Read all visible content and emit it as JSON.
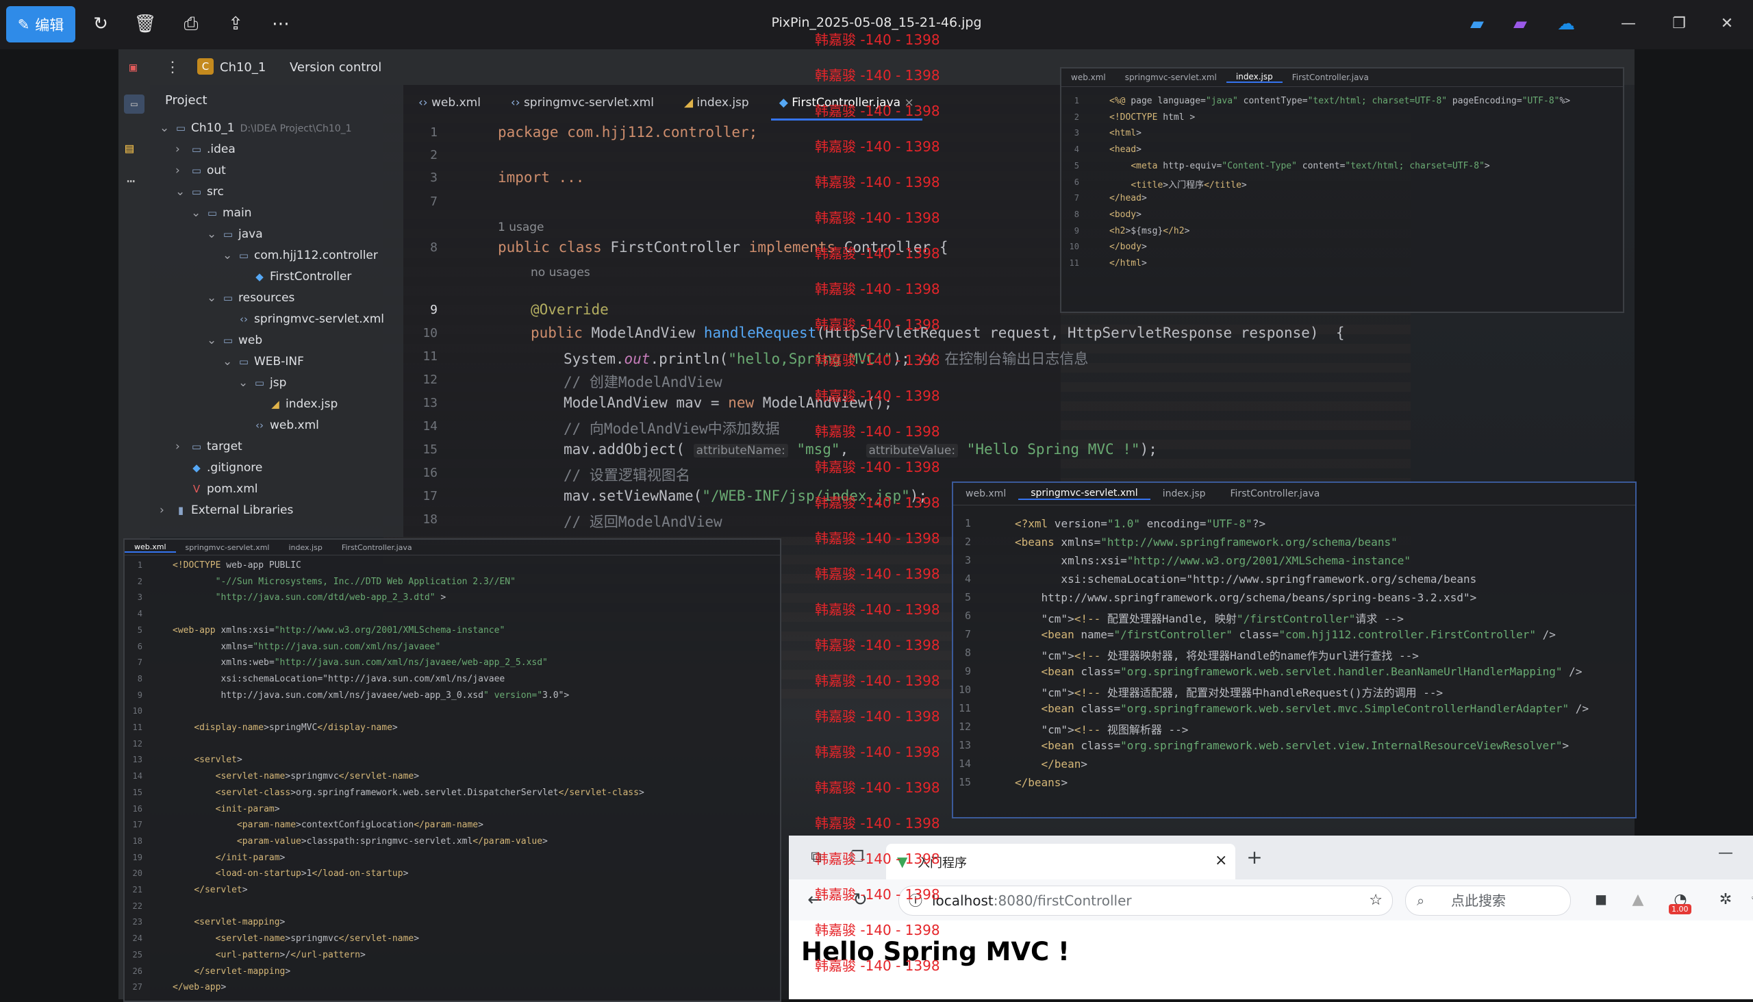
{
  "viewer": {
    "edit_label": "编辑",
    "title": "PixPin_2025-05-08_15-21-46.jpg",
    "icons": [
      "rotate-icon",
      "delete-icon",
      "print-icon",
      "share-icon",
      "more-icon"
    ]
  },
  "ide": {
    "project_initial": "C",
    "project_name": "Ch10_1",
    "vcs": "Version control",
    "panel_title": "Project",
    "tree": [
      {
        "indent": 0,
        "arrow": "⌄",
        "icon": "▭",
        "label": "Ch10_1",
        "suffix": "D:\\IDEA Project\\Ch10_1"
      },
      {
        "indent": 1,
        "arrow": "›",
        "icon": "▭",
        "label": ".idea",
        "suffix": ""
      },
      {
        "indent": 1,
        "arrow": "›",
        "icon": "▭",
        "label": "out",
        "suffix": ""
      },
      {
        "indent": 1,
        "arrow": "⌄",
        "icon": "▭",
        "label": "src",
        "suffix": ""
      },
      {
        "indent": 2,
        "arrow": "⌄",
        "icon": "▭",
        "label": "main",
        "suffix": ""
      },
      {
        "indent": 3,
        "arrow": "⌄",
        "icon": "▭",
        "label": "java",
        "suffix": ""
      },
      {
        "indent": 4,
        "arrow": "⌄",
        "icon": "▭",
        "label": "com.hjj112.controller",
        "suffix": ""
      },
      {
        "indent": 5,
        "arrow": "",
        "icon": "◆",
        "label": "FirstController",
        "suffix": ""
      },
      {
        "indent": 3,
        "arrow": "⌄",
        "icon": "▭",
        "label": "resources",
        "suffix": ""
      },
      {
        "indent": 4,
        "arrow": "",
        "icon": "‹›",
        "label": "springmvc-servlet.xml",
        "suffix": ""
      },
      {
        "indent": 3,
        "arrow": "⌄",
        "icon": "▭",
        "label": "web",
        "suffix": ""
      },
      {
        "indent": 4,
        "arrow": "⌄",
        "icon": "▭",
        "label": "WEB-INF",
        "suffix": ""
      },
      {
        "indent": 5,
        "arrow": "⌄",
        "icon": "▭",
        "label": "jsp",
        "suffix": ""
      },
      {
        "indent": 6,
        "arrow": "",
        "icon": "◢",
        "label": "index.jsp",
        "suffix": ""
      },
      {
        "indent": 5,
        "arrow": "",
        "icon": "‹›",
        "label": "web.xml",
        "suffix": ""
      },
      {
        "indent": 1,
        "arrow": "›",
        "icon": "▭",
        "label": "target",
        "suffix": ""
      },
      {
        "indent": 1,
        "arrow": "",
        "icon": "◆",
        "label": ".gitignore",
        "suffix": ""
      },
      {
        "indent": 1,
        "arrow": "",
        "icon": "V",
        "label": "pom.xml",
        "suffix": ""
      },
      {
        "indent": 0,
        "arrow": "›",
        "icon": "▮",
        "label": "External Libraries",
        "suffix": ""
      }
    ],
    "tabs": [
      "web.xml",
      "springmvc-servlet.xml",
      "index.jsp",
      "FirstController.java"
    ],
    "line_numbers": [
      "1",
      "2",
      "3",
      "7",
      "",
      "8",
      "",
      "",
      "9",
      "10",
      "11",
      "12",
      "13",
      "14",
      "15",
      "16",
      "17",
      "18"
    ],
    "code": {
      "l1": "package com.hjj112.controller;",
      "l3": "import ...",
      "usage": "1 usage",
      "l8a": "public class ",
      "l8b": "FirstController ",
      "l8c": "implements ",
      "l8d": "Controller {",
      "no_usages": "no usages",
      "override": "@Override",
      "l10a": "public ",
      "l10b": "ModelAndView ",
      "l10c": "handleRequest",
      "l10d": "(HttpServletRequest request, HttpServletResponse response)  {",
      "l11a": "System.",
      "l11b": "out",
      "l11c": ".println(",
      "l11d": "\"hello,Spring MVC!\"",
      "l11e": "); ",
      "l11f": "// 在控制台输出日志信息",
      "l12": "// 创建ModelAndView",
      "l13a": "ModelAndView mav = ",
      "l13b": "new ",
      "l13c": "ModelAndView();",
      "l14": "// 向ModelAndView中添加数据",
      "l15a": "mav.addObject( ",
      "h1": "attributeName:",
      "l15b": " \"msg\"",
      "l15c": ",  ",
      "h2": "attributeValue:",
      "l15d": " \"Hello Spring MVC !\"",
      "l15e": ");",
      "l16": "// 设置逻辑视图名",
      "l17a": "mav.setViewName(",
      "l17b": "\"/WEB-INF/jsp/index.jsp\"",
      "l17c": ");",
      "l18": "// 返回ModelAndView"
    }
  },
  "jsp_panel": {
    "tabs": [
      "web.xml",
      "springmvc-servlet.xml",
      "index.jsp",
      "FirstController.java"
    ],
    "lines": [
      "<%@ page language=\"java\" contentType=\"text/html; charset=UTF-8\" pageEncoding=\"UTF-8\"%>",
      "<!DOCTYPE html >",
      "<html>",
      "<head>",
      "    <meta http-equiv=\"Content-Type\" content=\"text/html; charset=UTF-8\">",
      "    <title>入门程序</title>",
      "</head>",
      "<body>",
      "<h2>${msg}</h2>",
      "</body>",
      "</html>"
    ]
  },
  "servlet_panel": {
    "tabs": [
      "web.xml",
      "springmvc-servlet.xml",
      "index.jsp",
      "FirstController.java"
    ],
    "lines": [
      "<?xml version=\"1.0\" encoding=\"UTF-8\"?>",
      "<beans xmlns=\"http://www.springframework.org/schema/beans\"",
      "       xmlns:xsi=\"http://www.w3.org/2001/XMLSchema-instance\"",
      "       xsi:schemaLocation=\"http://www.springframework.org/schema/beans",
      "    http://www.springframework.org/schema/beans/spring-beans-3.2.xsd\">",
      "    <!-- 配置处理器Handle, 映射\"/firstController\"请求 -->",
      "    <bean name=\"/firstController\" class=\"com.hjj112.controller.FirstController\" />",
      "    <!-- 处理器映射器, 将处理器Handle的name作为url进行查找 -->",
      "    <bean class=\"org.springframework.web.servlet.handler.BeanNameUrlHandlerMapping\" />",
      "    <!-- 处理器适配器, 配置对处理器中handleRequest()方法的调用 -->",
      "    <bean class=\"org.springframework.web.servlet.mvc.SimpleControllerHandlerAdapter\" />",
      "    <!-- 视图解析器 -->",
      "    <bean class=\"org.springframework.web.servlet.view.InternalResourceViewResolver\">",
      "    </bean>",
      "</beans>"
    ]
  },
  "webxml_panel": {
    "tabs": [
      "web.xml",
      "springmvc-servlet.xml",
      "index.jsp",
      "FirstController.java"
    ],
    "lines": [
      "<!DOCTYPE web-app PUBLIC",
      "        \"-//Sun Microsystems, Inc.//DTD Web Application 2.3//EN\"",
      "        \"http://java.sun.com/dtd/web-app_2_3.dtd\" >",
      "",
      "<web-app xmlns:xsi=\"http://www.w3.org/2001/XMLSchema-instance\"",
      "         xmlns=\"http://java.sun.com/xml/ns/javaee\"",
      "         xmlns:web=\"http://java.sun.com/xml/ns/javaee/web-app_2_5.xsd\"",
      "         xsi:schemaLocation=\"http://java.sun.com/xml/ns/javaee",
      "         http://java.sun.com/xml/ns/javaee/web-app_3_0.xsd\" version=\"3.0\">",
      "",
      "    <display-name>springMVC</display-name>",
      "",
      "    <servlet>",
      "        <servlet-name>springmvc</servlet-name>",
      "        <servlet-class>org.springframework.web.servlet.DispatcherServlet</servlet-class>",
      "        <init-param>",
      "            <param-name>contextConfigLocation</param-name>",
      "            <param-value>classpath:springmvc-servlet.xml</param-value>",
      "        </init-param>",
      "        <load-on-startup>1</load-on-startup>",
      "    </servlet>",
      "",
      "    <servlet-mapping>",
      "        <servlet-name>springmvc</servlet-name>",
      "        <url-pattern>/</url-pattern>",
      "    </servlet-mapping>",
      "</web-app>"
    ]
  },
  "browser": {
    "tab_title": "入门程序",
    "url_host": "localhost",
    "url_rest": ":8080/firstController",
    "search_placeholder": "点此搜索",
    "badge": "1.00",
    "heading": "Hello Spring MVC !"
  },
  "watermark": "韩嘉骏 -140 - 1398",
  "colors": {
    "accent": "#2f8be8",
    "ide_bg": "#1e1f22",
    "keyword": "#cf8e6d",
    "string": "#6aab73",
    "watermark": "#e5252a"
  }
}
